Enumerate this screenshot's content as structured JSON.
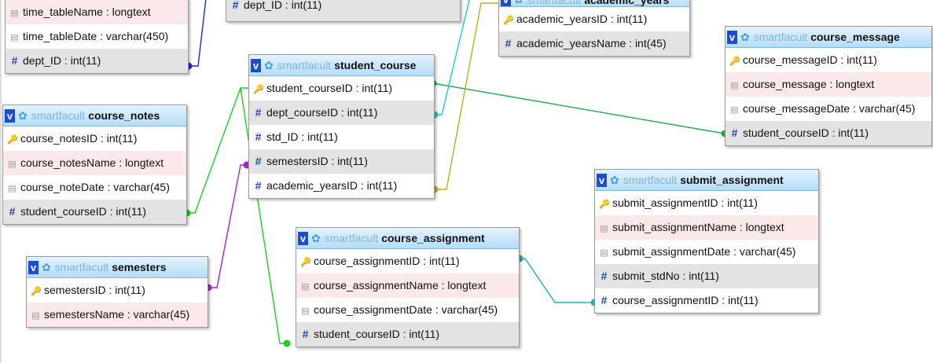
{
  "diagram": {
    "db": "smartfacult",
    "tables": [
      {
        "id": "time_table",
        "name": "",
        "columns": [
          {
            "label": "time_tableName : longtext",
            "kind": "text"
          },
          {
            "label": "time_tableDate : varchar(450)",
            "kind": "text"
          },
          {
            "label": "dept_ID : int(11)",
            "kind": "num"
          }
        ]
      },
      {
        "id": "top_mid",
        "name": "",
        "columns": [
          {
            "label": "dept_ID : int(11)",
            "kind": "num"
          }
        ]
      },
      {
        "id": "academic_years",
        "name": "academic_years",
        "columns": [
          {
            "label": "academic_yearsID : int(11)",
            "kind": "key"
          },
          {
            "label": "academic_yearsName : int(45)",
            "kind": "num"
          }
        ]
      },
      {
        "id": "course_message",
        "name": "course_message",
        "columns": [
          {
            "label": "course_messageID : int(11)",
            "kind": "key"
          },
          {
            "label": "course_message : longtext",
            "kind": "text"
          },
          {
            "label": "course_messageDate : varchar(45)",
            "kind": "text"
          },
          {
            "label": "student_courseID : int(11)",
            "kind": "num"
          }
        ]
      },
      {
        "id": "student_course",
        "name": "student_course",
        "columns": [
          {
            "label": "student_courseID : int(11)",
            "kind": "key"
          },
          {
            "label": "dept_courseID : int(11)",
            "kind": "num"
          },
          {
            "label": "std_ID : int(11)",
            "kind": "num"
          },
          {
            "label": "semestersID : int(11)",
            "kind": "num"
          },
          {
            "label": "academic_yearsID : int(11)",
            "kind": "num"
          }
        ]
      },
      {
        "id": "course_notes",
        "name": "course_notes",
        "columns": [
          {
            "label": "course_notesID : int(11)",
            "kind": "key"
          },
          {
            "label": "course_notesName : longtext",
            "kind": "text"
          },
          {
            "label": "course_noteDate : varchar(45)",
            "kind": "text"
          },
          {
            "label": "student_courseID : int(11)",
            "kind": "num"
          }
        ]
      },
      {
        "id": "submit_assignment",
        "name": "submit_assignment",
        "columns": [
          {
            "label": "submit_assignmentID : int(11)",
            "kind": "key"
          },
          {
            "label": "submit_assignmentName : longtext",
            "kind": "text"
          },
          {
            "label": "submit_assignmentDate : varchar(45)",
            "kind": "text"
          },
          {
            "label": "submit_stdNo : int(11)",
            "kind": "num"
          },
          {
            "label": "course_assignmentID : int(11)",
            "kind": "num"
          }
        ]
      },
      {
        "id": "course_assignment",
        "name": "course_assignment",
        "columns": [
          {
            "label": "course_assignmentID : int(11)",
            "kind": "key"
          },
          {
            "label": "course_assignmentName : longtext",
            "kind": "text"
          },
          {
            "label": "course_assignmentDate : varchar(45)",
            "kind": "text"
          },
          {
            "label": "student_courseID : int(11)",
            "kind": "num"
          }
        ]
      },
      {
        "id": "semesters",
        "name": "semesters",
        "columns": [
          {
            "label": "semestersID : int(11)",
            "kind": "key"
          },
          {
            "label": "semestersName : varchar(45)",
            "kind": "text"
          }
        ]
      }
    ],
    "relations": [
      {
        "from": "course_notes.student_courseID",
        "to": "student_course.student_courseID",
        "color": "#22cc22"
      },
      {
        "from": "course_assignment.student_courseID",
        "to": "student_course.student_courseID",
        "color": "#22cc22"
      },
      {
        "from": "course_message.student_courseID",
        "to": "student_course.student_courseID",
        "color": "#22aa44"
      },
      {
        "from": "semesters.semestersID",
        "to": "student_course.semestersID",
        "color": "#aa22cc"
      },
      {
        "from": "student_course.academic_yearsID",
        "to": "academic_years.academic_yearsID",
        "color": "#b8b020"
      },
      {
        "from": "student_course.dept_courseID",
        "to": "dept_course",
        "color": "#22c8c8"
      },
      {
        "from": "submit_assignment.course_assignmentID",
        "to": "course_assignment.course_assignmentID",
        "color": "#20b0b0"
      },
      {
        "from": "time_table.dept_ID",
        "to": "dept",
        "color": "#1a2fd0"
      }
    ]
  }
}
